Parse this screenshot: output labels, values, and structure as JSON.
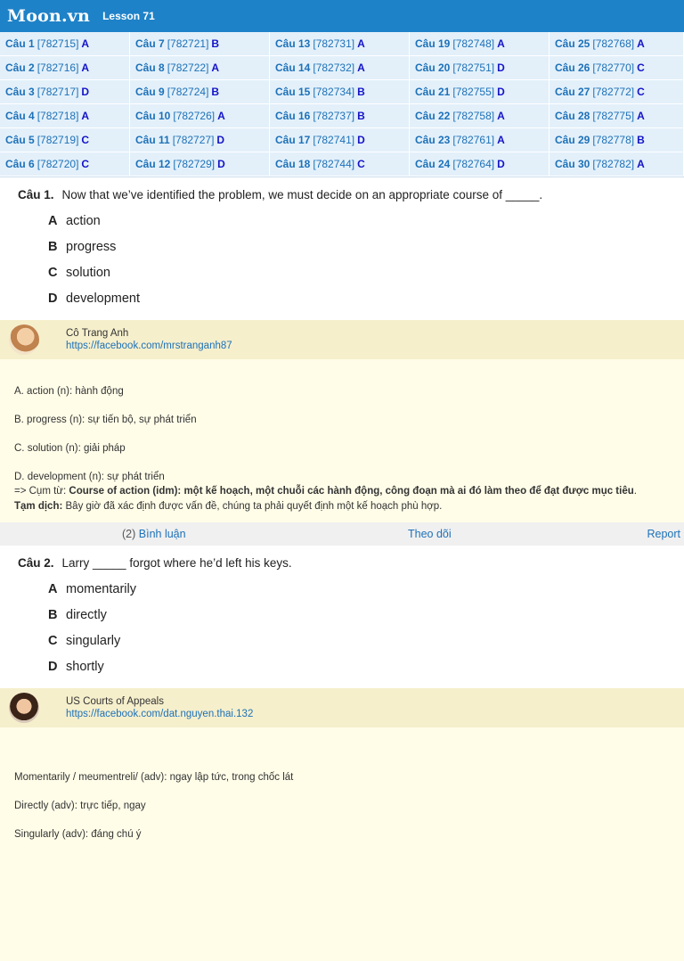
{
  "header": {
    "logo": "Moon.vn",
    "lesson": "Lesson 71"
  },
  "answers": [
    {
      "q": "Câu 1",
      "id": "[782715]",
      "a": "A"
    },
    {
      "q": "Câu 7",
      "id": "[782721]",
      "a": "B"
    },
    {
      "q": "Câu 13",
      "id": "[782731]",
      "a": "A"
    },
    {
      "q": "Câu 19",
      "id": "[782748]",
      "a": "A"
    },
    {
      "q": "Câu 25",
      "id": "[782768]",
      "a": "A"
    },
    {
      "q": "Câu 2",
      "id": "[782716]",
      "a": "A"
    },
    {
      "q": "Câu 8",
      "id": "[782722]",
      "a": "A"
    },
    {
      "q": "Câu 14",
      "id": "[782732]",
      "a": "A"
    },
    {
      "q": "Câu 20",
      "id": "[782751]",
      "a": "D"
    },
    {
      "q": "Câu 26",
      "id": "[782770]",
      "a": "C"
    },
    {
      "q": "Câu 3",
      "id": "[782717]",
      "a": "D"
    },
    {
      "q": "Câu 9",
      "id": "[782724]",
      "a": "B"
    },
    {
      "q": "Câu 15",
      "id": "[782734]",
      "a": "B"
    },
    {
      "q": "Câu 21",
      "id": "[782755]",
      "a": "D"
    },
    {
      "q": "Câu 27",
      "id": "[782772]",
      "a": "C"
    },
    {
      "q": "Câu 4",
      "id": "[782718]",
      "a": "A"
    },
    {
      "q": "Câu 10",
      "id": "[782726]",
      "a": "A"
    },
    {
      "q": "Câu 16",
      "id": "[782737]",
      "a": "B"
    },
    {
      "q": "Câu 22",
      "id": "[782758]",
      "a": "A"
    },
    {
      "q": "Câu 28",
      "id": "[782775]",
      "a": "A"
    },
    {
      "q": "Câu 5",
      "id": "[782719]",
      "a": "C"
    },
    {
      "q": "Câu 11",
      "id": "[782727]",
      "a": "D"
    },
    {
      "q": "Câu 17",
      "id": "[782741]",
      "a": "D"
    },
    {
      "q": "Câu 23",
      "id": "[782761]",
      "a": "A"
    },
    {
      "q": "Câu 29",
      "id": "[782778]",
      "a": "B"
    },
    {
      "q": "Câu 6",
      "id": "[782720]",
      "a": "C"
    },
    {
      "q": "Câu 12",
      "id": "[782729]",
      "a": "D"
    },
    {
      "q": "Câu 18",
      "id": "[782744]",
      "a": "C"
    },
    {
      "q": "Câu 24",
      "id": "[782764]",
      "a": "D"
    },
    {
      "q": "Câu 30",
      "id": "[782782]",
      "a": "A"
    }
  ],
  "q1": {
    "label": "Câu 1.",
    "text": "Now that we’ve identified the problem, we must decide on an appropriate course of _____.",
    "options": [
      {
        "letter": "A",
        "text": "action"
      },
      {
        "letter": "B",
        "text": "progress"
      },
      {
        "letter": "C",
        "text": "solution"
      },
      {
        "letter": "D",
        "text": "development"
      }
    ],
    "teacher": {
      "name": "Cô Trang Anh",
      "link": "https://facebook.com/mrstranganh87"
    },
    "explain": {
      "l1": "A. action (n): hành động",
      "l2": "B. progress (n): sự tiến bộ, sự phát triển",
      "l3": "C. solution (n): giải pháp",
      "l4": "D. development (n): sự phát triển",
      "l5_prefix": "=> Cụm từ: ",
      "l5_bold": "Course of action (idm): một kế hoạch, một chuỗi các hành động, công đoạn mà ai đó làm theo để đạt được mục tiêu",
      "l5_end": ".",
      "l6_label": "Tạm dịch:",
      "l6_text": " Bây giờ đã xác định được vấn đề, chúng ta phải quyết định một kế hoạch phù hợp."
    },
    "comments": {
      "count": "(2)",
      "label": "Bình luận"
    },
    "follow": "Theo dõi",
    "report": "Report"
  },
  "q2": {
    "label": "Câu 2.",
    "text": "Larry _____ forgot where he’d left his keys.",
    "options": [
      {
        "letter": "A",
        "text": "momentarily"
      },
      {
        "letter": "B",
        "text": "directly"
      },
      {
        "letter": "C",
        "text": "singularly"
      },
      {
        "letter": "D",
        "text": "shortly"
      }
    ],
    "teacher": {
      "name": "US Courts of Appeals",
      "link": "https://facebook.com/dat.nguyen.thai.132"
    },
    "explain": {
      "l1": "Momentarily / meʊmentreli/ (adv): ngay lập tức, trong chốc lát",
      "l2": "Directly (adv): trực tiếp, ngay",
      "l3": "Singularly (adv): đáng chú ý"
    }
  }
}
